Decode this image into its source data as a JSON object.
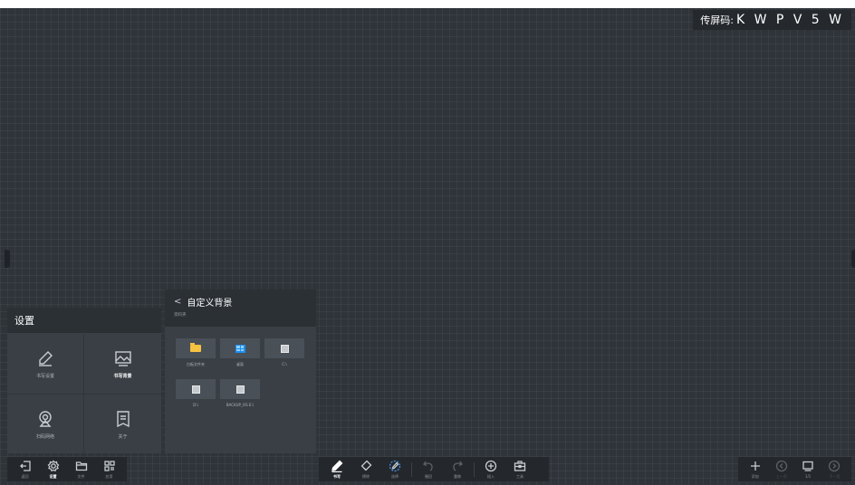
{
  "screen_code": {
    "label": "传屏码:",
    "code": "K W P V 5 W"
  },
  "settings_panel": {
    "title": "设置",
    "items": [
      {
        "label": "书写设置",
        "icon": "pen-settings-icon",
        "active": false
      },
      {
        "label": "书写背景",
        "icon": "picture-icon",
        "active": true
      },
      {
        "label": "扫码网络",
        "icon": "location-pin-icon",
        "active": false
      },
      {
        "label": "关于",
        "icon": "document-icon",
        "active": false
      }
    ]
  },
  "background_panel": {
    "back_glyph": "<",
    "title": "自定义背景",
    "subtitle": "资料夹",
    "files": [
      {
        "name": "白板文件夹",
        "icon": "folder-icon"
      },
      {
        "name": "桌面",
        "icon": "desktop-icon"
      },
      {
        "name": "C:\\",
        "icon": "drive-icon"
      },
      {
        "name": "D:\\",
        "icon": "drive-icon"
      },
      {
        "name": "BACKUP_OS E:\\",
        "icon": "drive-icon"
      }
    ]
  },
  "toolbar_left": {
    "items": [
      {
        "label": "返回",
        "icon": "exit-icon"
      },
      {
        "label": "设置",
        "icon": "gear-icon",
        "active": true
      },
      {
        "label": "文件",
        "icon": "folder-icon"
      },
      {
        "label": "应用",
        "icon": "apps-icon"
      }
    ]
  },
  "toolbar_center": {
    "items": [
      {
        "label": "书写",
        "icon": "pen-icon",
        "active": true
      },
      {
        "label": "擦除",
        "icon": "eraser-icon"
      },
      {
        "label": "选择",
        "icon": "lasso-icon"
      },
      {
        "label": "撤回",
        "icon": "undo-icon"
      },
      {
        "label": "重做",
        "icon": "redo-icon"
      },
      {
        "label": "插入",
        "icon": "plus-circle-icon"
      },
      {
        "label": "工具",
        "icon": "toolbox-icon"
      }
    ]
  },
  "toolbar_right": {
    "add_label": "添加",
    "prev_label": "上一页",
    "page_indicator": "1/1",
    "next_label": "下一页"
  }
}
